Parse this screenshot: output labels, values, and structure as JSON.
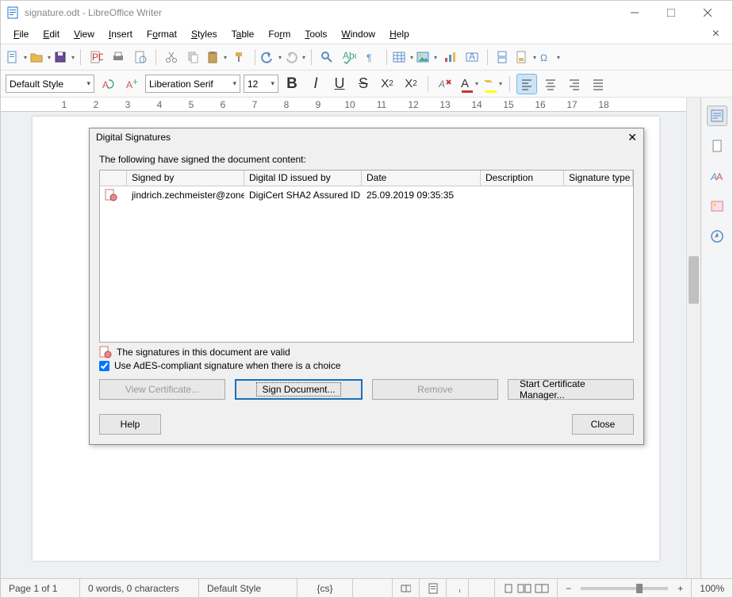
{
  "titlebar": {
    "title": "signature.odt - LibreOffice Writer"
  },
  "menu": [
    "File",
    "Edit",
    "View",
    "Insert",
    "Format",
    "Styles",
    "Table",
    "Form",
    "Tools",
    "Window",
    "Help"
  ],
  "format": {
    "para_style": "Default Style",
    "font_name": "Liberation Serif",
    "font_size": "12"
  },
  "ruler": {
    "ticks": [
      1,
      2,
      3,
      4,
      5,
      6,
      7,
      8,
      9,
      10,
      11,
      12,
      13,
      14,
      15,
      16,
      17,
      18
    ]
  },
  "dialog": {
    "title": "Digital Signatures",
    "intro": "The following have signed the document content:",
    "columns": {
      "signed_by": "Signed by",
      "issued_by": "Digital ID issued by",
      "date": "Date",
      "description": "Description",
      "sig_type": "Signature type"
    },
    "rows": [
      {
        "signed_by": "jindrich.zechmeister@zone",
        "issued_by": "DigiCert SHA2 Assured ID C",
        "date": "25.09.2019 09:35:35",
        "description": "",
        "sig_type": ""
      }
    ],
    "valid_msg": "The signatures in this document are valid",
    "ades_label": "Use AdES-compliant signature when there is a choice",
    "ades_checked": true,
    "buttons": {
      "view_cert": "View Certificate...",
      "sign_doc": "Sign Document...",
      "remove": "Remove",
      "start_mgr": "Start Certificate Manager...",
      "help": "Help",
      "close": "Close"
    }
  },
  "status": {
    "page": "Page 1 of 1",
    "words": "0 words, 0 characters",
    "style": "Default Style",
    "lang": "{cs}",
    "zoom": "100%"
  }
}
